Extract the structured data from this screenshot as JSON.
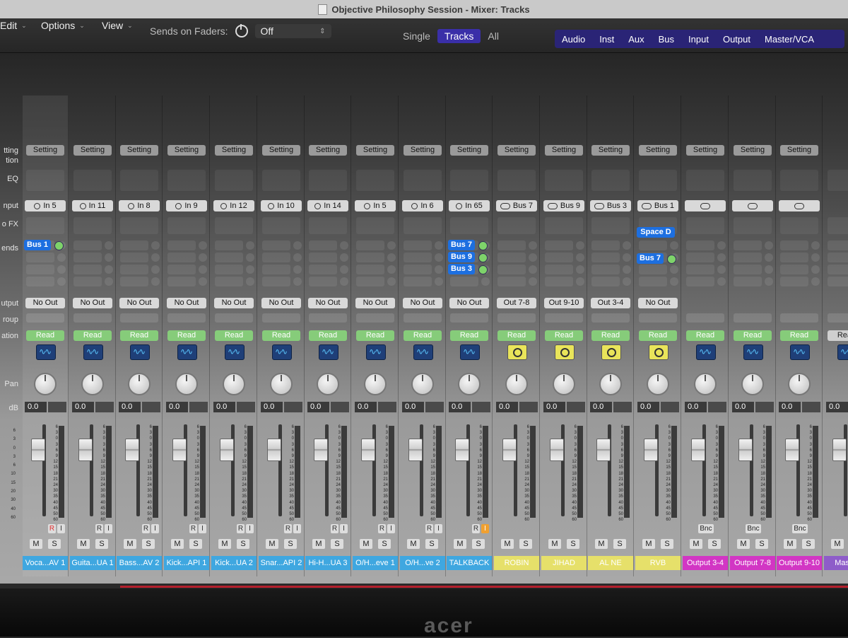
{
  "window": {
    "title": "Objective Philosophy Session - Mixer: Tracks"
  },
  "menu": {
    "edit": "Edit",
    "options": "Options",
    "view": "View"
  },
  "sends_on_faders": {
    "label": "Sends on Faders:",
    "value": "Off"
  },
  "view_mode": {
    "single": "Single",
    "tracks": "Tracks",
    "all": "All",
    "selected": "Tracks"
  },
  "filters": [
    "Audio",
    "Inst",
    "Aux",
    "Bus",
    "Input",
    "Output",
    "Master/VCA"
  ],
  "row_labels": {
    "setting": "tting",
    "setting2": "tion",
    "eq": "EQ",
    "input": "nput",
    "fx": "o FX",
    "sends": "ends",
    "output": "utput",
    "group": "roup",
    "automation": "ation",
    "pan": "Pan",
    "db": "dB"
  },
  "fader_scale": [
    "6",
    "3",
    "0",
    "3",
    "6",
    "9",
    "12",
    "15",
    "18",
    "21",
    "24",
    "30",
    "35",
    "40",
    "45",
    "50",
    "60"
  ],
  "left_scale": [
    "6",
    "3",
    "0",
    "3",
    "6",
    "10",
    "15",
    "20",
    "30",
    "40",
    "60"
  ],
  "colors": {
    "audio": "#3fa7e0",
    "talkback": "#3fa7e0",
    "aux": "#e6e06a",
    "output": "#d236c4",
    "master": "#8e5cc9",
    "read": "#86cc7a",
    "send": "#1d6fe0"
  },
  "strips": [
    {
      "setting": "Setting",
      "input": "In 5",
      "input_type": "ring",
      "sends": [
        {
          "label": "Bus 1"
        }
      ],
      "output": "No Out",
      "automation": "Read",
      "icon": "waveform-icon",
      "db": "0.0",
      "ri": true,
      "rec_armed": true,
      "input_monitor": false,
      "name": "Voca...AV 1",
      "color": "#3fa7e0"
    },
    {
      "setting": "Setting",
      "input": "In 11",
      "input_type": "ring",
      "sends": [],
      "output": "No Out",
      "automation": "Read",
      "icon": "waveform-icon",
      "db": "0.0",
      "ri": true,
      "name": "Guita...UA 1",
      "color": "#3fa7e0"
    },
    {
      "setting": "Setting",
      "input": "In 8",
      "input_type": "ring",
      "sends": [],
      "output": "No Out",
      "automation": "Read",
      "icon": "waveform-icon",
      "db": "0.0",
      "ri": true,
      "name": "Bass...AV 2",
      "color": "#3fa7e0"
    },
    {
      "setting": "Setting",
      "input": "In 9",
      "input_type": "ring",
      "sends": [],
      "output": "No Out",
      "automation": "Read",
      "icon": "waveform-icon",
      "db": "0.0",
      "ri": true,
      "name": "Kick...API 1",
      "color": "#3fa7e0"
    },
    {
      "setting": "Setting",
      "input": "In 12",
      "input_type": "ring",
      "sends": [],
      "output": "No Out",
      "automation": "Read",
      "icon": "waveform-icon",
      "db": "0.0",
      "ri": true,
      "name": "Kick...UA 2",
      "color": "#3fa7e0"
    },
    {
      "setting": "Setting",
      "input": "In 10",
      "input_type": "ring",
      "sends": [],
      "output": "No Out",
      "automation": "Read",
      "icon": "waveform-icon",
      "db": "0.0",
      "ri": true,
      "name": "Snar...API 2",
      "color": "#3fa7e0"
    },
    {
      "setting": "Setting",
      "input": "In 14",
      "input_type": "ring",
      "sends": [],
      "output": "No Out",
      "automation": "Read",
      "icon": "waveform-icon",
      "db": "0.0",
      "ri": true,
      "name": "Hi-H...UA 3",
      "color": "#3fa7e0"
    },
    {
      "setting": "Setting",
      "input": "In 5",
      "input_type": "ring",
      "sends": [],
      "output": "No Out",
      "automation": "Read",
      "icon": "waveform-icon",
      "db": "0.0",
      "ri": true,
      "name": "O/H...eve 1",
      "color": "#3fa7e0"
    },
    {
      "setting": "Setting",
      "input": "In 6",
      "input_type": "ring",
      "sends": [],
      "output": "No Out",
      "automation": "Read",
      "icon": "waveform-icon",
      "db": "0.0",
      "ri": true,
      "name": "O/H...ve 2",
      "color": "#3fa7e0"
    },
    {
      "setting": "Setting",
      "input": "In 65",
      "input_type": "ring",
      "sends": [
        {
          "label": "Bus 7"
        },
        {
          "label": "Bus 9"
        },
        {
          "label": "Bus 3"
        }
      ],
      "output": "No Out",
      "automation": "Read",
      "icon": "waveform-icon",
      "db": "0.0",
      "ri": true,
      "input_monitor": true,
      "name": "TALKBACK",
      "color": "#3fa7e0"
    },
    {
      "setting": "Setting",
      "input": "Bus 7",
      "input_type": "link",
      "sends": [],
      "output": "Out 7-8",
      "automation": "Read",
      "icon": "knob-icon",
      "db": "0.0",
      "ri": false,
      "name": "ROBIN",
      "color": "#e6e06a"
    },
    {
      "setting": "Setting",
      "input": "Bus 9",
      "input_type": "link",
      "sends": [],
      "output": "Out 9-10",
      "automation": "Read",
      "icon": "knob-icon",
      "db": "0.0",
      "ri": false,
      "name": "JIHAD",
      "color": "#e6e06a"
    },
    {
      "setting": "Setting",
      "input": "Bus 3",
      "input_type": "link",
      "sends": [],
      "output": "Out 3-4",
      "automation": "Read",
      "icon": "knob-icon",
      "db": "0.0",
      "ri": false,
      "name": "AL NE",
      "color": "#e6e06a"
    },
    {
      "setting": "Setting",
      "input": "Bus 1",
      "input_type": "link",
      "plugin": "Space D",
      "sends": [
        {
          "label": "Bus 7"
        }
      ],
      "output": "No Out",
      "automation": "Read",
      "icon": "knob-icon",
      "db": "0.0",
      "ri": false,
      "name": "RVB",
      "color": "#e6e06a"
    },
    {
      "setting": "Setting",
      "input": "",
      "input_type": "link",
      "sends": [],
      "output": "",
      "automation": "Read",
      "icon": "waveform-icon",
      "db": "0.0",
      "ri": false,
      "bnc": "Bnc",
      "name": "Output 3-4",
      "color": "#d236c4"
    },
    {
      "setting": "Setting",
      "input": "",
      "input_type": "link",
      "sends": [],
      "output": "",
      "automation": "Read",
      "icon": "waveform-icon",
      "db": "0.0",
      "ri": false,
      "bnc": "Bnc",
      "name": "Output 7-8",
      "color": "#d236c4"
    },
    {
      "setting": "Setting",
      "input": "",
      "input_type": "link",
      "sends": [],
      "output": "",
      "automation": "Read",
      "icon": "waveform-icon",
      "db": "0.0",
      "ri": false,
      "bnc": "Bnc",
      "name": "Output 9-10",
      "color": "#d236c4"
    },
    {
      "setting": "",
      "input": "",
      "input_type": "none",
      "sends": [],
      "output": "",
      "automation": "Read",
      "icon": "waveform-icon",
      "db": "0.0",
      "ri": false,
      "name": "Master",
      "color": "#8e5cc9",
      "master": true
    }
  ],
  "monitor_brand": "acer"
}
